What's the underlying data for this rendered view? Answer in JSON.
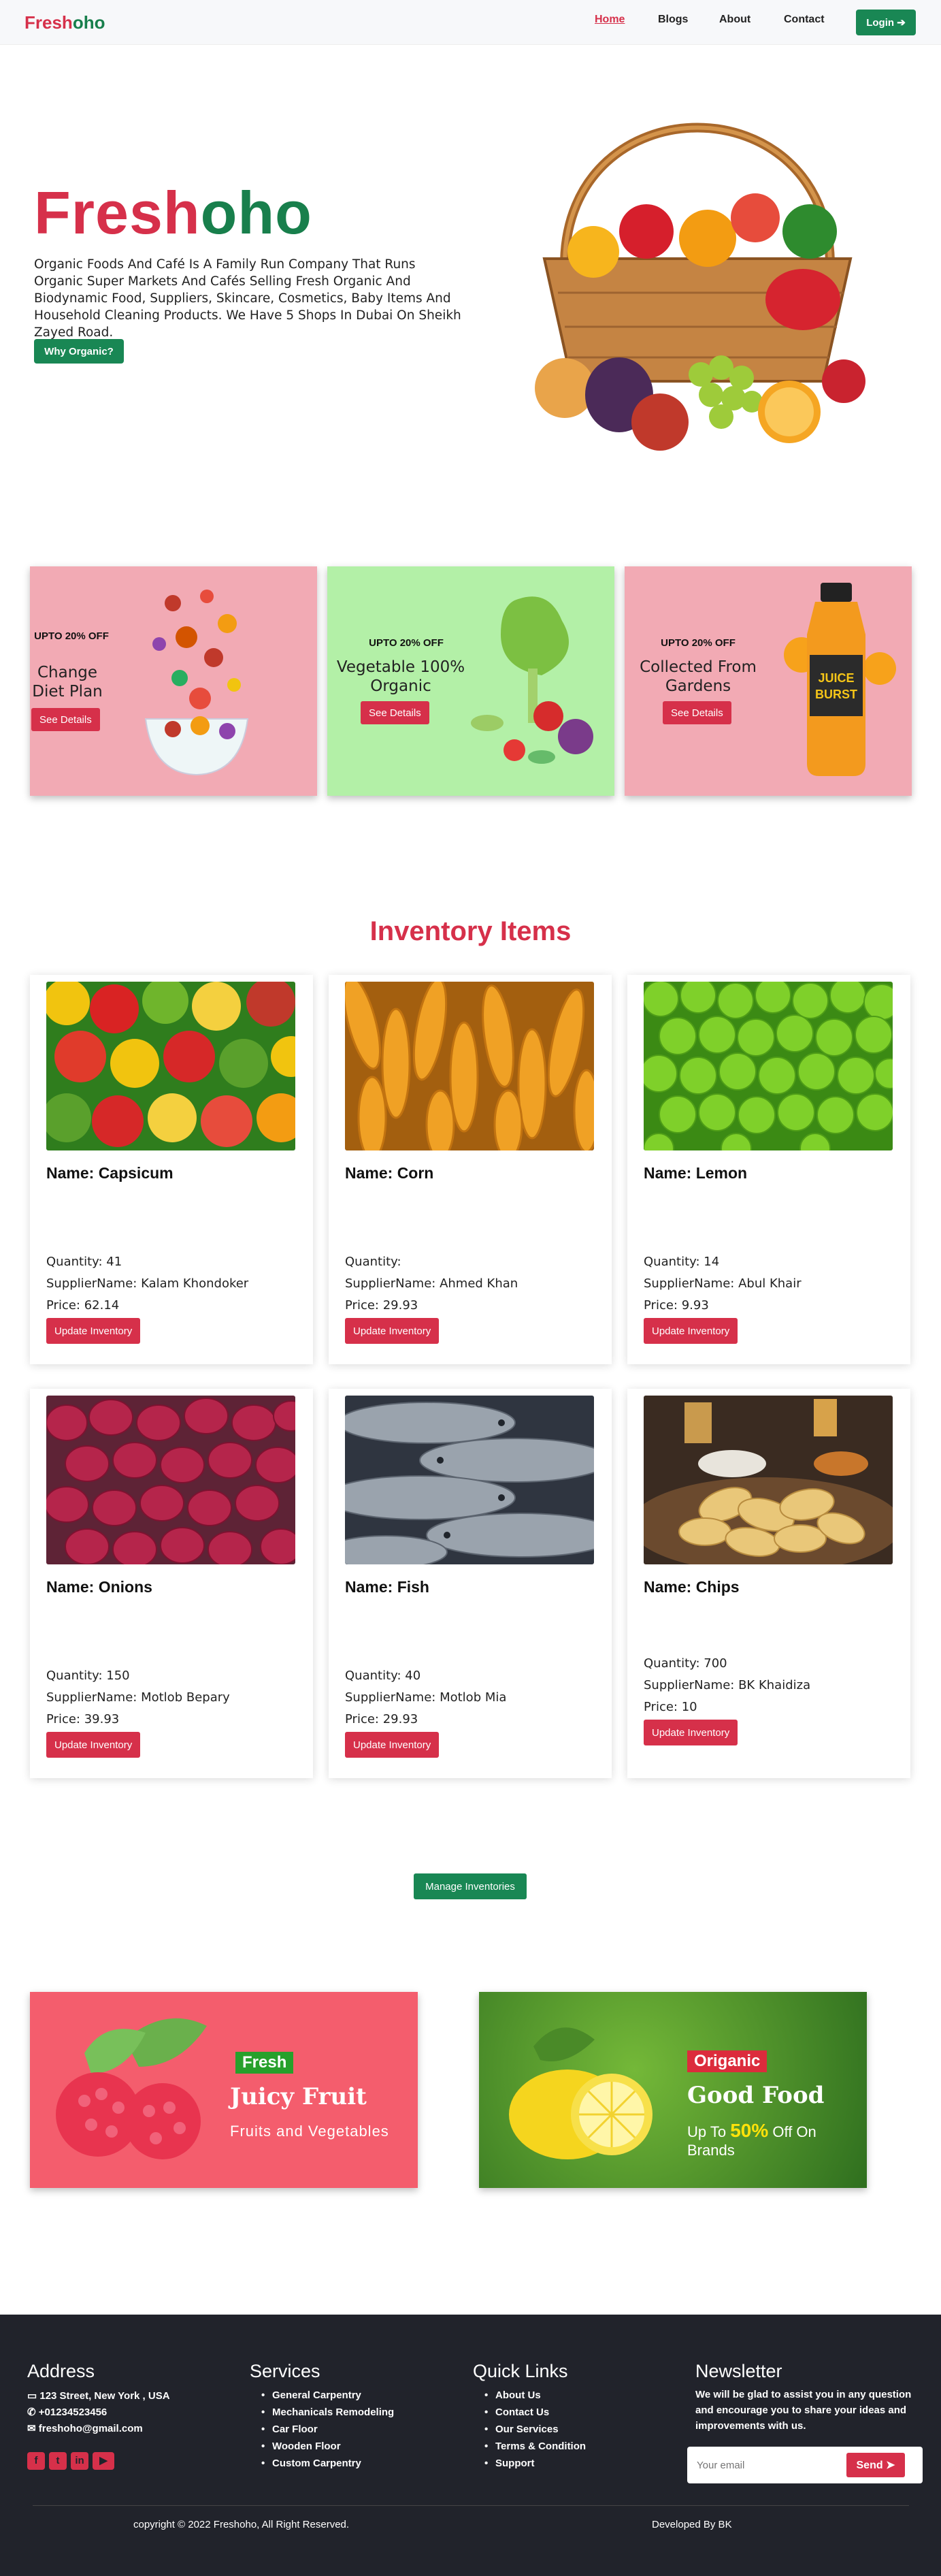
{
  "nav": {
    "logo_part1": "Fresh",
    "logo_part2": "oho",
    "links": [
      "Home",
      "Blogs",
      "About",
      "Contact"
    ],
    "login": "Login"
  },
  "hero": {
    "title_part1": "Fresh",
    "title_part2": "oho",
    "description": "Organic Foods And Café Is A Family Run Company That Runs Organic Super Markets And Cafés Selling Fresh Organic And Biodynamic Food, Suppliers, Skincare, Cosmetics, Baby Items And Household Cleaning Products. We Have 5 Shops In Dubai On Sheikh Zayed Road.",
    "button": "Why Organic?"
  },
  "promos": [
    {
      "tag": "UPTO 20% OFF",
      "title": "Change Diet Plan",
      "button": "See Details",
      "bg": "#f2aab4"
    },
    {
      "tag": "UPTO 20% OFF",
      "title": "Vegetable 100% Organic",
      "button": "See Details",
      "bg": "#b3f0a7"
    },
    {
      "tag": "UPTO 20% OFF",
      "title": "Collected From Gardens",
      "button": "See Details",
      "bg": "#f2aab4"
    }
  ],
  "inventory": {
    "title": "Inventory Items",
    "qty_label": "Quantity:",
    "supplier_label": "SupplierName:",
    "price_label": "Price:",
    "button": "Update Inventory",
    "items": [
      {
        "name": "Name: Capsicum",
        "quantity": "41",
        "supplier": "Kalam Khondoker",
        "price": "62.14"
      },
      {
        "name": "Name: Corn",
        "quantity": "",
        "supplier": "Ahmed Khan",
        "price": "29.93"
      },
      {
        "name": "Name: Lemon",
        "quantity": "14",
        "supplier": "Abul Khair",
        "price": "9.93"
      },
      {
        "name": "Name: Onions",
        "quantity": "150",
        "supplier": "Motlob Bepary",
        "price": "39.93"
      },
      {
        "name": "Name: Fish",
        "quantity": "40",
        "supplier": "Motlob Mia",
        "price": "29.93"
      },
      {
        "name": "Name: Chips",
        "quantity": "700",
        "supplier": "BK Khaidiza",
        "price": "10"
      }
    ],
    "manage": "Manage Inventories"
  },
  "banners": [
    {
      "badge": "Fresh",
      "title": "Juicy Fruit",
      "subtitle": "Fruits and Vegetables",
      "bg": "#f45d6d",
      "badge_color": "#27a02b"
    },
    {
      "badge": "Origanic",
      "title": "Good Food",
      "subtitle_pre": "Up To",
      "highlight": "50%",
      "subtitle_post": "Off On Brands",
      "bg": "#4c9a2c",
      "badge_color": "#dc2c3c"
    }
  ],
  "footer": {
    "address_title": "Address",
    "address": "123 Street, New York , USA",
    "phone": "+01234523456",
    "email": "freshoho@gmail.com",
    "services_title": "Services",
    "services": [
      "General Carpentry",
      "Mechanicals Remodeling",
      "Car Floor",
      "Wooden Floor",
      "Custom Carpentry"
    ],
    "links_title": "Quick Links",
    "links": [
      "About Us",
      "Contact Us",
      "Our Services",
      "Terms & Condition",
      "Support"
    ],
    "newsletter_title": "Newsletter",
    "newsletter_text": "We will be glad to assist you in any question and encourage you to share your ideas and improvements with us.",
    "email_placeholder": "Your email",
    "send": "Send",
    "copyright": "copyright © 2022 Freshoho, All Right Reserved.",
    "developer": "Developed By BK"
  }
}
